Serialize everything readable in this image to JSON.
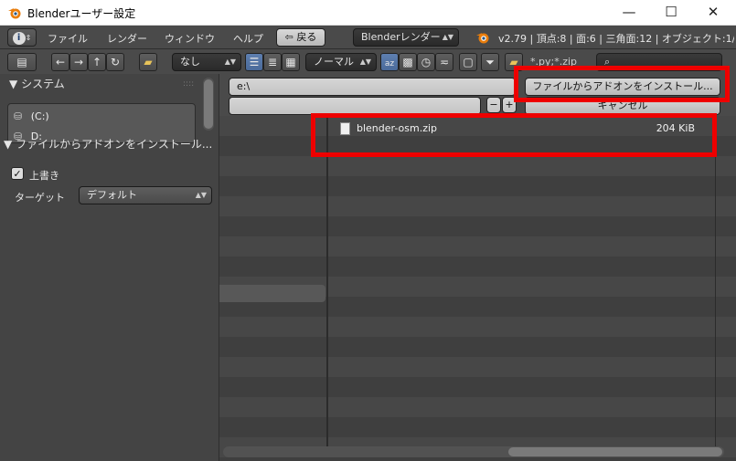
{
  "window": {
    "title": "Blenderユーザー設定",
    "min_glyph": "—",
    "max_glyph": "☐",
    "close_glyph": "✕"
  },
  "header": {
    "menus": [
      "ファイル",
      "レンダー",
      "ウィンドウ",
      "ヘルプ"
    ],
    "back_label": "戻る",
    "engine": "Blenderレンダー",
    "status": "v2.79 | 頂点:8 | 面:6 | 三角面:12 | オブジェクト:1/3"
  },
  "toolbar": {
    "recent_select": "なし",
    "display_select": "ノーマル",
    "filter_text": "*.py;*.zip"
  },
  "left_panel": {
    "system_heading": "システム",
    "drives": [
      "(C:)",
      "D:"
    ],
    "operator_heading": "ファイルからアドオンをインストール...",
    "overwrite_label": "上書き",
    "overwrite_checked": true,
    "target_label": "ターゲット",
    "target_value": "デフォルト"
  },
  "path": {
    "directory": "e:\\",
    "filename": ""
  },
  "actions": {
    "install_label": "ファイルからアドオンをインストール...",
    "cancel_label": "キャンセル",
    "minus": "−",
    "plus": "+"
  },
  "files": [
    {
      "name": "blender-osm.zip",
      "size": "204 KiB"
    }
  ],
  "colors": {
    "highlight": "#ee0000",
    "accent": "#5e7fb0"
  }
}
